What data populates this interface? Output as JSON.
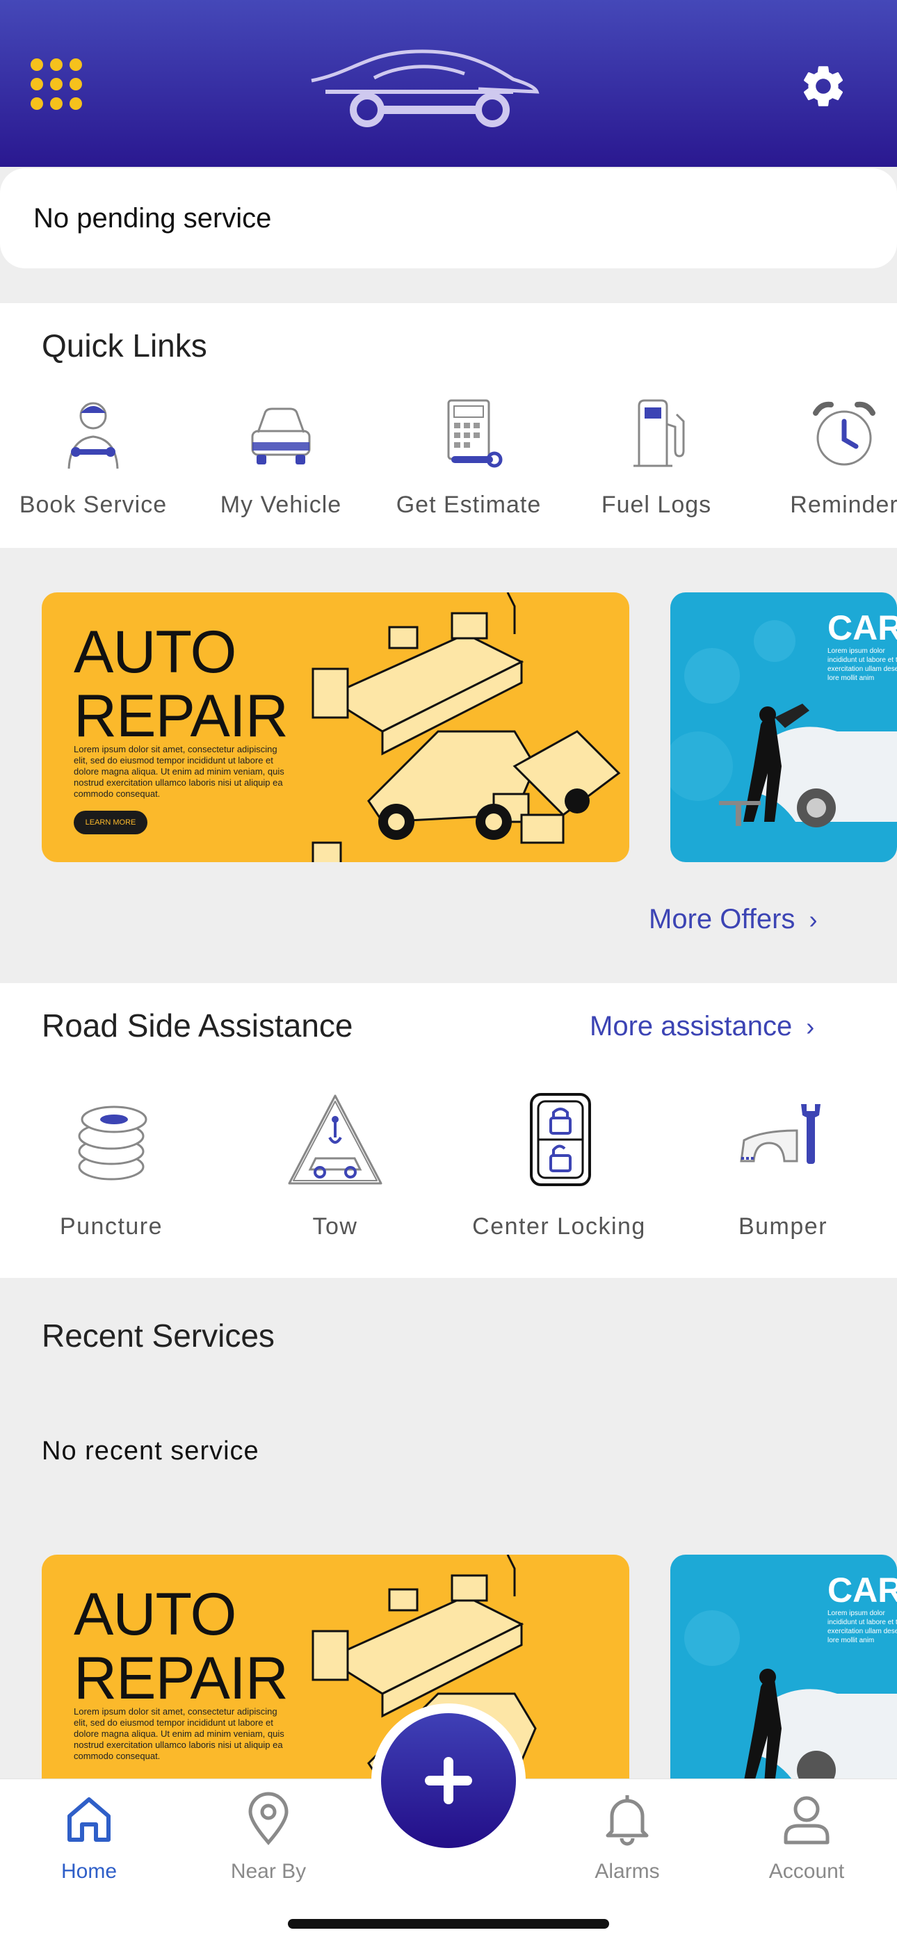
{
  "header": {
    "menu_icon": "apps-grid-icon",
    "logo_icon": "car-wrench-logo",
    "settings_icon": "gear-icon"
  },
  "pending": {
    "text": "No pending service"
  },
  "quick_links": {
    "title": "Quick Links",
    "items": [
      {
        "label": "Book Service",
        "icon": "mechanic-icon"
      },
      {
        "label": "My Vehicle",
        "icon": "car-icon"
      },
      {
        "label": "Get Estimate",
        "icon": "calculator-icon"
      },
      {
        "label": "Fuel Logs",
        "icon": "fuel-pump-icon"
      },
      {
        "label": "Reminder",
        "icon": "alarm-clock-icon"
      }
    ]
  },
  "offers": {
    "banner1": {
      "title_line1": "AUTO",
      "title_line2": "REPAIR",
      "body": "Lorem ipsum dolor sit amet, consectetur adipiscing elit, sed do eiusmod tempor incididunt ut labore et dolore magna aliqua. Ut enim ad minim veniam, quis nostrud exercitation ullamco laboris nisi ut aliquip ea commodo consequat.",
      "button": "LEARN MORE"
    },
    "banner2": {
      "title": "CAR",
      "body": "Lorem ipsum dolor incididunt ut labore et trud exercitation ullam deserunt lore mollit anim"
    },
    "more_link": "More Offers"
  },
  "roadside": {
    "title": "Road Side Assistance",
    "more_link": "More assistance",
    "items": [
      {
        "label": "Puncture",
        "icon": "tire-stack-icon"
      },
      {
        "label": "Tow",
        "icon": "tow-truck-icon"
      },
      {
        "label": "Center Locking",
        "icon": "lock-unlock-icon"
      },
      {
        "label": "Bumper",
        "icon": "bumper-wrench-icon"
      }
    ]
  },
  "recent": {
    "title": "Recent Services",
    "empty_text": "No recent service"
  },
  "tabbar": {
    "items": [
      {
        "label": "Home",
        "icon": "home-icon",
        "active": true
      },
      {
        "label": "Near By",
        "icon": "location-pin-icon",
        "active": false
      },
      {
        "label": "Alarms",
        "icon": "bell-icon",
        "active": false
      },
      {
        "label": "Account",
        "icon": "user-icon",
        "active": false
      }
    ],
    "fab_icon": "plus-icon"
  },
  "colors": {
    "header_top": "#4548b8",
    "header_bottom": "#2a1890",
    "accent": "#3c44b4",
    "menu_dots": "#f6c11c",
    "banner_yellow": "#fbb92b",
    "banner_blue": "#1da9d6",
    "tab_active": "#2f5fc8"
  }
}
